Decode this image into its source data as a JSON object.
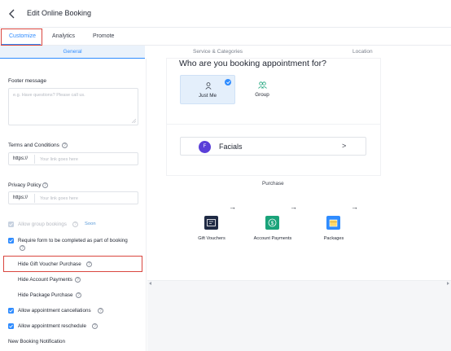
{
  "header": {
    "title": "Edit Online Booking",
    "back_icon": "chevron-left-icon"
  },
  "tabs": [
    {
      "label": "Customize",
      "active": true
    },
    {
      "label": "Analytics",
      "active": false
    },
    {
      "label": "Promote",
      "active": false
    }
  ],
  "subnav": {
    "general": "General",
    "service": "Service & Categories",
    "location": "Location"
  },
  "settings": {
    "footer_message": {
      "label": "Footer message",
      "placeholder": "e.g. Have questions? Please call us."
    },
    "terms": {
      "label": "Terms and Conditions",
      "prefix": "https://",
      "placeholder": "Your link goes here"
    },
    "privacy": {
      "label": "Privacy Policy",
      "prefix": "https://",
      "placeholder": "Your link goes here"
    },
    "options": [
      {
        "label": "Allow group bookings",
        "checked": true,
        "disabled": true,
        "badge": "Soon"
      },
      {
        "label": "Require form to be completed as part of booking",
        "checked": true
      },
      {
        "label": "Hide Gift Voucher Purchase",
        "checked": false
      },
      {
        "label": "Hide Account Payments",
        "checked": false
      },
      {
        "label": "Hide Package Purchase",
        "checked": false
      },
      {
        "label": "Allow appointment cancellations",
        "checked": true
      },
      {
        "label": "Allow appointment reschedule",
        "checked": true
      }
    ],
    "new_booking_notification": "New Booking Notification"
  },
  "preview": {
    "question": "Who are you booking appointment for?",
    "choices": [
      {
        "label": "Just Me",
        "selected": true
      },
      {
        "label": "Group",
        "selected": false
      }
    ],
    "category": {
      "initial": "F",
      "label": "Facials",
      "chevron": ">"
    },
    "purchase_title": "Purchase",
    "purchase_cards": [
      {
        "label": "Gift Vouchers",
        "icon": "gift-voucher-icon",
        "color": "#1f2a44"
      },
      {
        "label": "Account Payments",
        "icon": "dollar-icon",
        "color": "#1aa37a"
      },
      {
        "label": "Packages",
        "icon": "package-icon",
        "color": "#2f8cff"
      }
    ],
    "arrow": "→"
  },
  "colors": {
    "accent": "#2f8cff",
    "highlight": "#d9463f",
    "avatar": "#5a3fd8"
  }
}
